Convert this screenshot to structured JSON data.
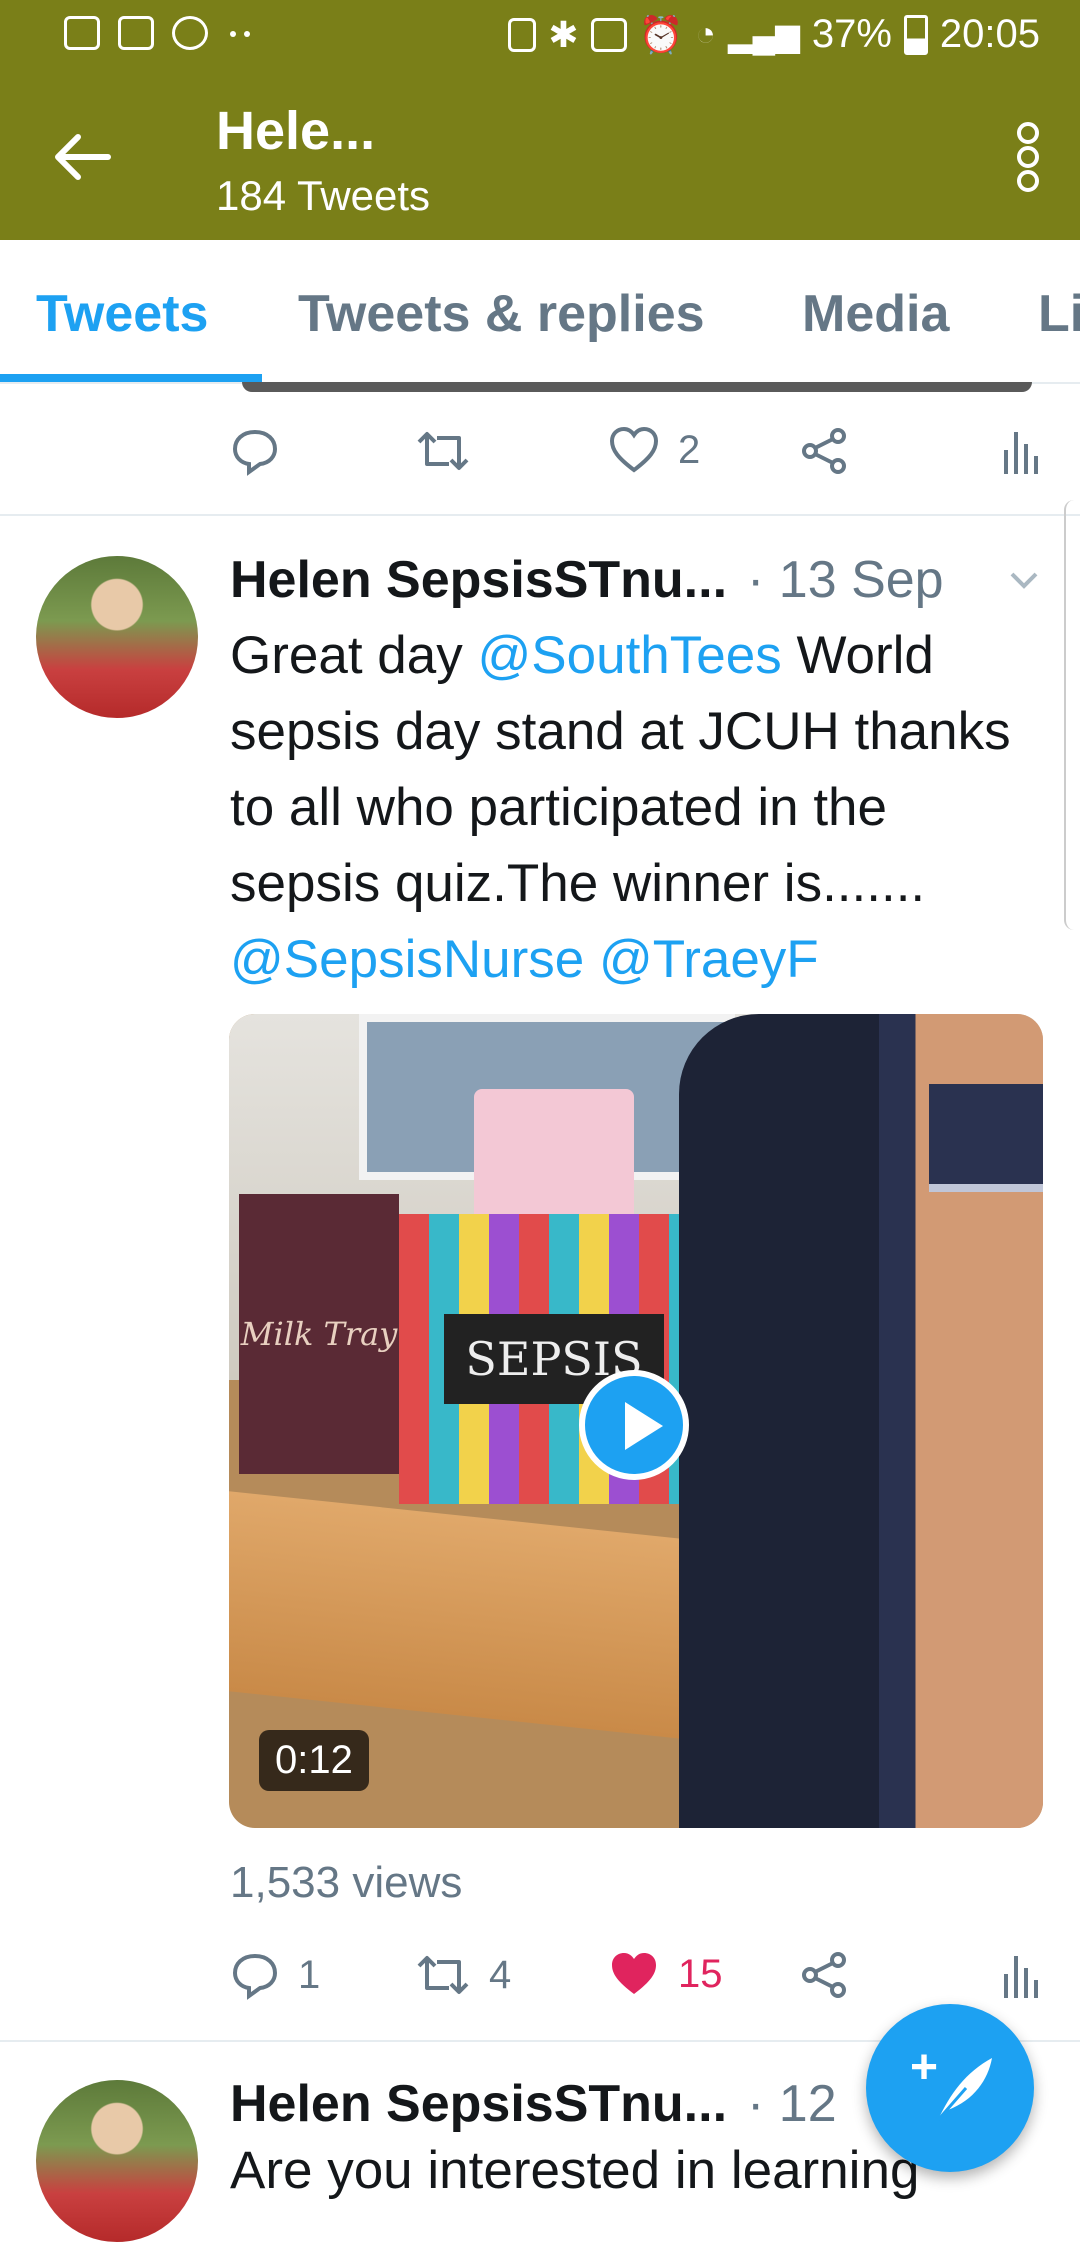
{
  "status_bar": {
    "battery": "37%",
    "time": "20:05"
  },
  "app_bar": {
    "title": "Hele...",
    "subtitle": "184 Tweets"
  },
  "tabs": [
    {
      "label": "Tweets",
      "active": true
    },
    {
      "label": "Tweets & replies",
      "active": false
    },
    {
      "label": "Media",
      "active": false
    },
    {
      "label": "Li",
      "active": false
    }
  ],
  "prev_tweet": {
    "likes": "2"
  },
  "tweet": {
    "name": "Helen SepsisSTnu...",
    "date": "· 13 Sep",
    "text_parts": {
      "t1": "Great day ",
      "m1": "@SouthTees",
      "t2": " World sepsis day stand at JCUH thanks to all who participated in the sepsis quiz.The winner is....... ",
      "m2": "@SepsisNurse",
      "t3": " ",
      "m3": "@TraeyF"
    },
    "media": {
      "sign_text": "SEPSIS",
      "choc_text": "Milk Tray",
      "duration": "0:12"
    },
    "views": "1,533 views",
    "replies": "1",
    "retweets": "4",
    "likes": "15"
  },
  "next_tweet": {
    "name": "Helen SepsisSTnu...",
    "date": "· 12",
    "text": "Are you interested in learning"
  },
  "colors": {
    "app_bar": "#7a7f18",
    "accent": "#1da1f2",
    "like_active": "#e0245e",
    "secondary_text": "#657786"
  }
}
